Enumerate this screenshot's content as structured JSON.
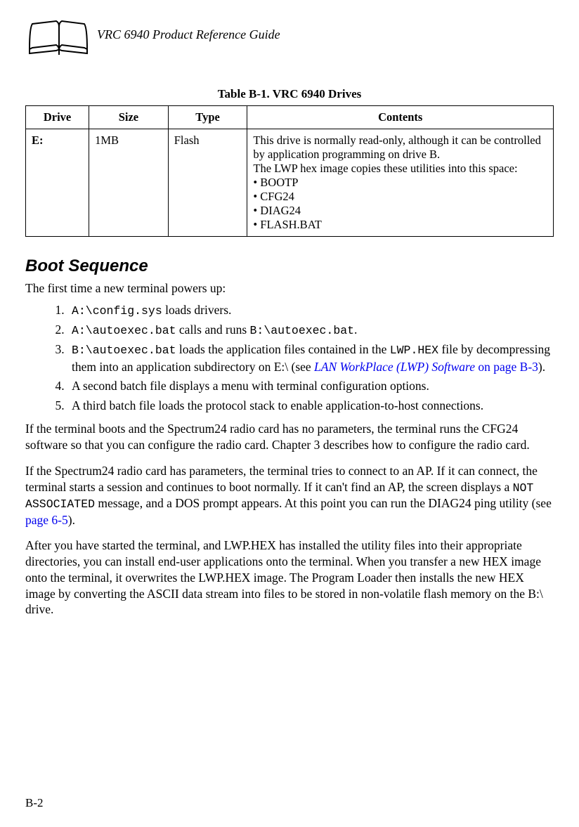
{
  "header": {
    "title": "VRC 6940 Product Reference Guide"
  },
  "table": {
    "caption": "Table B-1. VRC 6940 Drives",
    "headers": {
      "drive": "Drive",
      "size": "Size",
      "type": "Type",
      "contents": "Contents"
    },
    "row": {
      "drive": "E:",
      "size": "1MB",
      "type": "Flash",
      "contents_line1": "This drive is normally read-only, although it can be controlled by application programming on drive B.",
      "contents_line2": "The LWP hex image copies these utilities into this space:",
      "bullets": {
        "b1": "BOOTP",
        "b2": "CFG24",
        "b3": "DIAG24",
        "b4": "FLASH.BAT"
      }
    }
  },
  "section": {
    "heading": "Boot Sequence",
    "intro": "The first time a new terminal powers up:",
    "steps": {
      "s1_code": "A:\\config.sys",
      "s1_text": " loads drivers.",
      "s2_code1": "A:\\autoexec.bat",
      "s2_text1": " calls and runs ",
      "s2_code2": "B:\\autoexec.bat",
      "s2_text2": ".",
      "s3_code1": "B:\\autoexec.bat",
      "s3_text1": " loads the application files contained in the ",
      "s3_code2": "LWP.HEX",
      "s3_text2": " file by decompressing them into an application subdirectory on E:\\ (see ",
      "s3_link": "LAN WorkPlace (LWP) Software",
      "s3_link_suffix": " on page B-3",
      "s3_text3": ").",
      "s4": "A second batch file displays a menu with terminal configuration options.",
      "s5": "A third batch file loads the protocol stack to enable application-to-host connections."
    },
    "p1": "If the terminal boots and the Spectrum24 radio card has no parameters, the terminal runs the CFG24 software so that you can configure the radio card. Chapter 3 describes how to configure the radio card.",
    "p2_text1": "If the Spectrum24 radio card has parameters, the terminal tries to connect to an AP. If it can connect, the terminal starts a session and continues to boot normally. If it can't find an AP, the screen displays a ",
    "p2_code": "NOT ASSOCIATED",
    "p2_text2": " message, and a DOS prompt appears. At this point you can run the DIAG24 ping utility (see ",
    "p2_link": "page 6-5",
    "p2_text3": ").",
    "p3": "After you have started the terminal, and LWP.HEX has installed the utility files into their appropriate directories, you can install end-user applications onto the terminal. When you transfer a new HEX image onto the terminal, it overwrites the LWP.HEX image. The Program Loader then installs the new HEX image by converting the ASCII data stream into files to be stored in non-volatile flash memory on the B:\\ drive."
  },
  "footer": {
    "page": "B-2"
  }
}
